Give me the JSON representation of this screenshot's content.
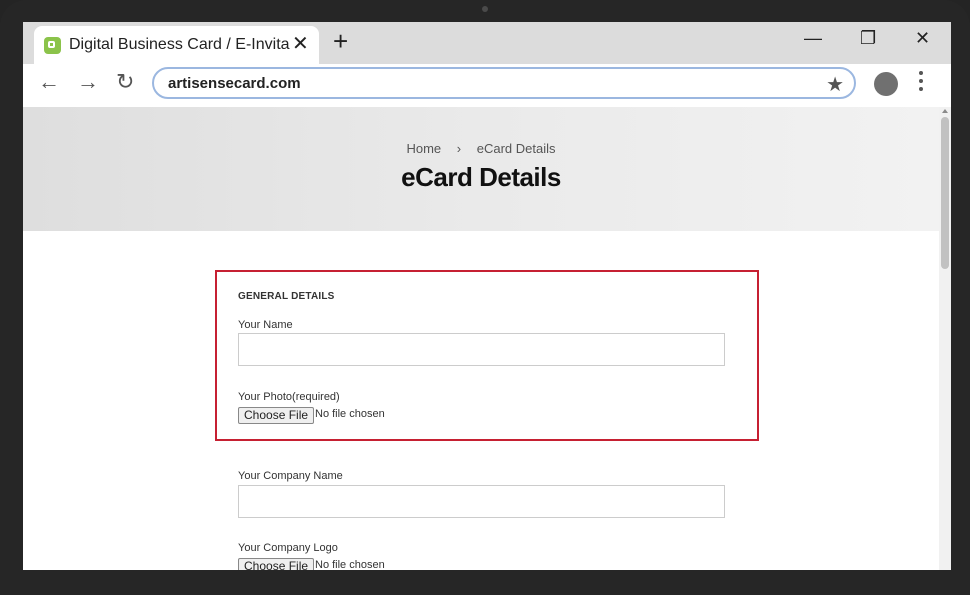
{
  "browser": {
    "tab_title": "Digital Business Card / E-Invita",
    "tab_close": "✕",
    "new_tab": "+",
    "window": {
      "minimize": "—",
      "restore": "❐",
      "close": "✕"
    },
    "nav": {
      "back": "←",
      "forward": "→",
      "reload": "↻"
    },
    "url": "artisensecard.com",
    "bookmark": "★"
  },
  "hero": {
    "breadcrumb": {
      "home": "Home",
      "separator": "›",
      "current": "eCard Details"
    },
    "title": "eCard Details"
  },
  "form": {
    "section_title": "GENERAL DETAILS",
    "name_label": "Your Name",
    "name_value": "",
    "photo_label": "Your Photo(required)",
    "photo_button": "Choose File",
    "photo_status": "No file chosen",
    "company_label": "Your Company Name",
    "company_value": "",
    "logo_label": "Your Company Logo",
    "logo_button": "Choose File",
    "logo_status": "No file chosen"
  },
  "colors": {
    "highlight_border": "#c62032",
    "favicon": "#8bc34a"
  }
}
